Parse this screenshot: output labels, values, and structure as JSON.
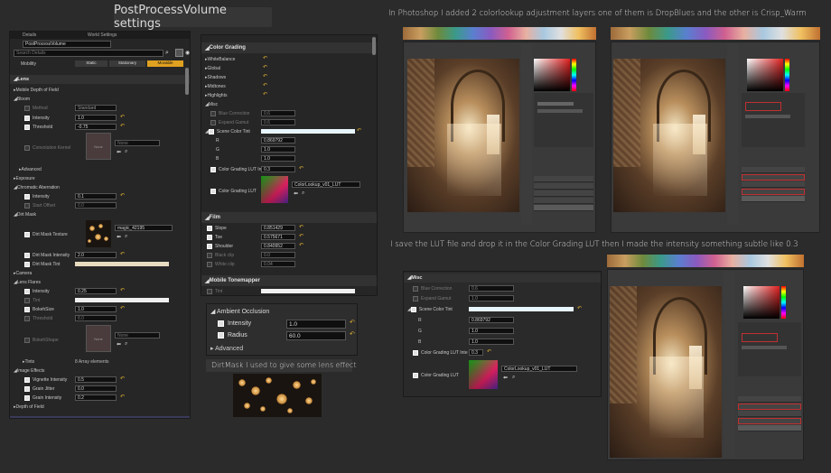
{
  "captions": {
    "main_title": "PostProcessVolume settings",
    "photoshop_note": "In Photoshop I added 2 colorlookup adjustment layers one of them is DropBlues and the other is Crisp_Warm",
    "lut_note": "I save the LUT file and drop it in the Color Grading LUT then I made the intensity something subtle like 0.3",
    "dirt_note": "DirtMask I used to give some lens effect"
  },
  "left_panel": {
    "tab1": "Details",
    "tab2": "World Settings",
    "object_name": "PostProcessVolume",
    "search_placeholder": "Search Details",
    "mobility_label": "Mobility",
    "mobility_options": [
      "Static",
      "Stationary",
      "Movable"
    ],
    "sections": {
      "lens": "Lens",
      "mobile_dof": "Mobile Depth of Field",
      "bloom": "Bloom",
      "advanced": "Advanced",
      "exposure": "Exposure",
      "chromatic": "Chromatic Aberration",
      "dirt_mask": "Dirt Mask",
      "camera": "Camera",
      "lens_flares": "Lens Flares",
      "image_effects": "Image Effects",
      "dof": "Depth of Field"
    },
    "bloom": {
      "method_label": "Method",
      "method_value": "Standard",
      "intensity_label": "Intensity",
      "intensity_value": "1.0",
      "threshold_label": "Threshold",
      "threshold_value": "-0.75",
      "convolution_label": "Convolution Kernel",
      "none": "None"
    },
    "chromatic": {
      "intensity_label": "Intensity",
      "intensity_value": "0.1",
      "offset_label": "Start Offset",
      "offset_value": "0.0"
    },
    "dirt": {
      "texture_label": "Dirt Mask Texture",
      "texture_value": "magic_42195",
      "intensity_label": "Dirt Mask Intensity",
      "intensity_value": "2.0",
      "tint_label": "Dirt Mask Tint"
    },
    "flares": {
      "intensity_label": "Intensity",
      "intensity_value": "0.25",
      "tint_label": "Tint",
      "bokeh_label": "BokehSize",
      "bokeh_value": "1.0",
      "threshold_label": "Threshold",
      "threshold_value": "8.0",
      "shape_label": "BokehShape",
      "tints_label": "Tints",
      "tints_value": "8 Array elements"
    },
    "image_effects": {
      "vignette_label": "Vignette Intensity",
      "vignette_value": "0.5",
      "grain_jitter_label": "Grain Jitter",
      "grain_jitter_value": "0.0",
      "grain_intensity_label": "Grain Intensity",
      "grain_intensity_value": "0.2"
    }
  },
  "mid_panel": {
    "color_grading": "Color Grading",
    "items": [
      "WhiteBalance",
      "Global",
      "Shadows",
      "Midtones",
      "Highlights",
      "Misc"
    ],
    "blue_correction": "Blue Correction",
    "blue_value": "0.6",
    "expand_gamut": "Expand Gamut",
    "expand_value": "0.6",
    "scene_tint": "Scene Color Tint",
    "r_label": "R",
    "r_value": "0.869792",
    "g_label": "G",
    "g_value": "1.0",
    "b_label": "B",
    "b_value": "1.0",
    "lut_intensity_label": "Color Grading LUT Inte",
    "lut_intensity_value": "0.3",
    "lut_label": "Color Grading LUT",
    "lut_value": "ColorLookup_v01_LUT",
    "film": "Film",
    "slope_label": "Slope",
    "slope_value": "0.851429",
    "toe_label": "Toe",
    "toe_value": "0.575671",
    "shoulder_label": "Shoulder",
    "shoulder_value": "0.840952",
    "blackclip_label": "Black clip",
    "blackclip_value": "0.0",
    "whiteclip_label": "White clip",
    "whiteclip_value": "0.04",
    "mobile_tonemapper": "Mobile Tonemapper",
    "tint_label": "Tint"
  },
  "ao_panel": {
    "header": "Ambient Occlusion",
    "intensity_label": "Intensity",
    "intensity_value": "1.0",
    "radius_label": "Radius",
    "radius_value": "60.0",
    "advanced": "Advanced"
  },
  "lower_panel": {
    "misc": "Misc",
    "blue_correction": "Blue Correction",
    "blue_value": "0.6",
    "expand_gamut": "Expand Gamut",
    "expand_value": "1.0",
    "scene_tint": "Scene Color Tint",
    "r_label": "R",
    "r_value": "0.869792",
    "g_label": "G",
    "g_value": "1.0",
    "b_label": "B",
    "b_value": "1.0",
    "lut_intensity_label": "Color Grading LUT Inte",
    "lut_intensity_value": "0.3",
    "lut_label": "Color Grading LUT",
    "lut_value": "ColorLookup_v01_LUT"
  }
}
